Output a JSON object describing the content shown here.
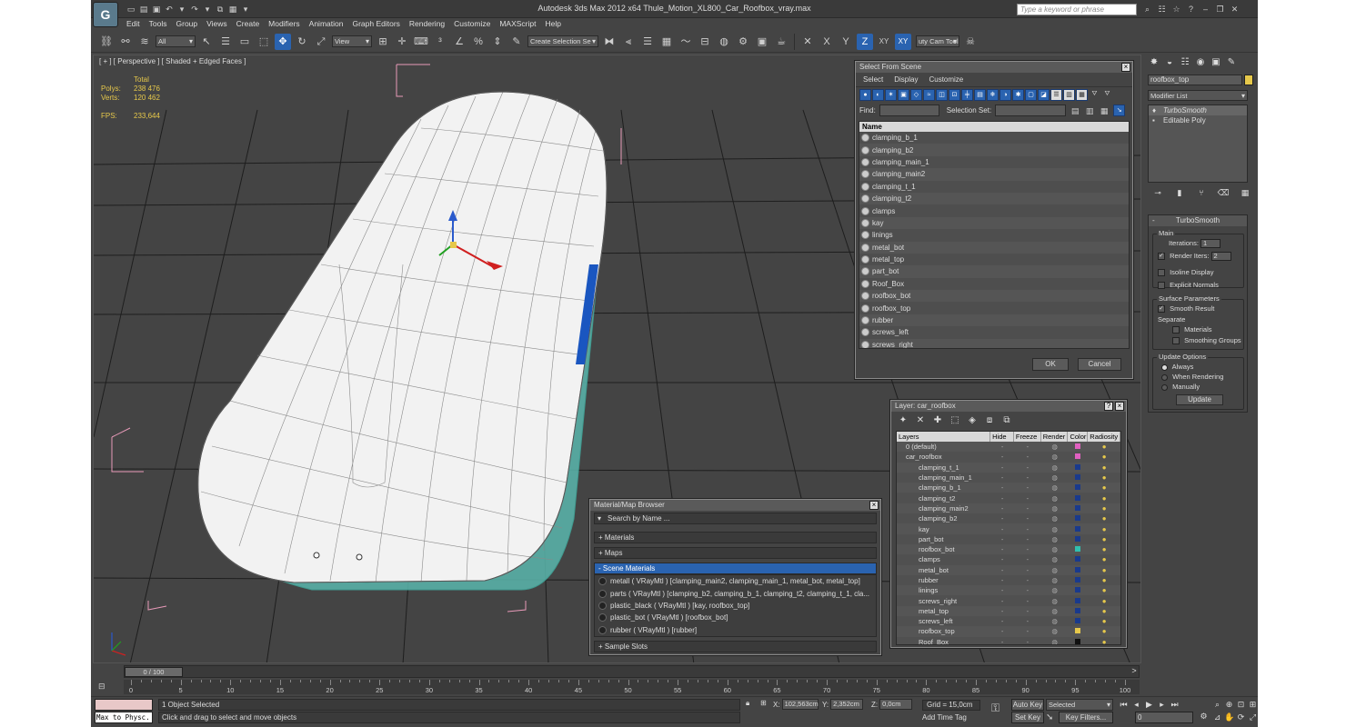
{
  "window": {
    "title": "Autodesk 3ds Max  2012 x64     Thule_Motion_XL800_Car_Roofbox_vray.max",
    "search_placeholder": "Type a keyword or phrase"
  },
  "menu": [
    "Edit",
    "Tools",
    "Group",
    "Views",
    "Create",
    "Modifiers",
    "Animation",
    "Graph Editors",
    "Rendering",
    "Customize",
    "MAXScript",
    "Help"
  ],
  "toolbar": {
    "filter": "All",
    "ref_coord": "View",
    "named_selection": "Create Selection Se",
    "axis_x": "X",
    "axis_y": "Y",
    "axis_z": "Z",
    "axis_xy": "XY",
    "axis_xy2": "XY",
    "camera_tool": "uty Cam Tool"
  },
  "viewport": {
    "label": "[ + ] [ Perspective ] [ Shaded + Edged Faces ]",
    "stats": {
      "header": "Total",
      "polys_label": "Polys:",
      "polys": "238 476",
      "verts_label": "Verts:",
      "verts": "120 462",
      "fps_label": "FPS:",
      "fps": "233,644"
    }
  },
  "select_from_scene": {
    "title": "Select From Scene",
    "menu": [
      "Select",
      "Display",
      "Customize"
    ],
    "find_label": "Find:",
    "selset_label": "Selection Set:",
    "column": "Name",
    "objects": [
      "clamping_b_1",
      "clamping_b2",
      "clamping_main_1",
      "clamping_main2",
      "clamping_t_1",
      "clamping_t2",
      "clamps",
      "kay",
      "linings",
      "metal_bot",
      "metal_top",
      "part_bot",
      "Roof_Box",
      "roofbox_bot",
      "roofbox_top",
      "rubber",
      "screws_left",
      "screws_right"
    ],
    "ok": "OK",
    "cancel": "Cancel"
  },
  "layer_dialog": {
    "title": "Layer: car_roofbox",
    "columns": [
      "Layers",
      "Hide",
      "Freeze",
      "Render",
      "Color",
      "Radiosity"
    ],
    "rows": [
      {
        "name": "0 (default)",
        "indent": 0,
        "color": "#e060c0"
      },
      {
        "name": "car_roofbox",
        "indent": 0,
        "color": "#e060c0"
      },
      {
        "name": "clamping_t_1",
        "indent": 1,
        "color": "#1a3a8c"
      },
      {
        "name": "clamping_main_1",
        "indent": 1,
        "color": "#1a3a8c"
      },
      {
        "name": "clamping_b_1",
        "indent": 1,
        "color": "#1a3a8c"
      },
      {
        "name": "clamping_t2",
        "indent": 1,
        "color": "#1a3a8c"
      },
      {
        "name": "clamping_main2",
        "indent": 1,
        "color": "#1a3a8c"
      },
      {
        "name": "clamping_b2",
        "indent": 1,
        "color": "#1a3a8c"
      },
      {
        "name": "kay",
        "indent": 1,
        "color": "#1a3a8c"
      },
      {
        "name": "part_bot",
        "indent": 1,
        "color": "#1a3a8c"
      },
      {
        "name": "roofbox_bot",
        "indent": 1,
        "color": "#30c0b0"
      },
      {
        "name": "clamps",
        "indent": 1,
        "color": "#1a3a8c"
      },
      {
        "name": "metal_bot",
        "indent": 1,
        "color": "#1a3a8c"
      },
      {
        "name": "rubber",
        "indent": 1,
        "color": "#1a3a8c"
      },
      {
        "name": "linings",
        "indent": 1,
        "color": "#1a3a8c"
      },
      {
        "name": "screws_right",
        "indent": 1,
        "color": "#1a3a8c"
      },
      {
        "name": "metal_top",
        "indent": 1,
        "color": "#1a3a8c"
      },
      {
        "name": "screws_left",
        "indent": 1,
        "color": "#1a3a8c"
      },
      {
        "name": "roofbox_top",
        "indent": 1,
        "color": "#e6c84b"
      },
      {
        "name": "Roof_Box",
        "indent": 1,
        "color": "#111111"
      }
    ]
  },
  "material_browser": {
    "title": "Material/Map Browser",
    "search_placeholder": "Search by Name ...",
    "sections": {
      "materials": "+ Materials",
      "maps": "+ Maps",
      "scene": "- Scene Materials",
      "samples": "+ Sample Slots"
    },
    "scene_materials": [
      "metall  ( VRayMtl ) [clamping_main2, clamping_main_1, metal_bot, metal_top]",
      "parts  ( VRayMtl ) [clamping_b2, clamping_b_1, clamping_t2, clamping_t_1, cla...",
      "plastic_black  ( VRayMtl ) [kay, roofbox_top]",
      "plastic_bot  ( VRayMtl ) [roofbox_bot]",
      "rubber  ( VRayMtl ) [rubber]"
    ]
  },
  "command_panel": {
    "object_name": "roofbox_top",
    "object_color": "#e6c84b",
    "modifier_list": "Modifier List",
    "stack": [
      "TurboSmooth",
      "Editable Poly"
    ],
    "rollout_title": "TurboSmooth",
    "main_label": "Main",
    "iterations_label": "Iterations:",
    "iterations": "1",
    "render_iters_label": "Render Iters:",
    "render_iters": "2",
    "isoline": "Isoline Display",
    "explicit_normals": "Explicit Normals",
    "surface_params": "Surface Parameters",
    "smooth_result": "Smooth Result",
    "separate": "Separate",
    "materials": "Materials",
    "smoothing_groups": "Smoothing Groups",
    "update_options": "Update Options",
    "always": "Always",
    "when_rendering": "When Rendering",
    "manually": "Manually",
    "update_btn": "Update"
  },
  "timeline": {
    "position": "0 / 100",
    "ticks": [
      "0",
      "5",
      "10",
      "15",
      "20",
      "25",
      "30",
      "35",
      "40",
      "45",
      "50",
      "55",
      "60",
      "65",
      "70",
      "75",
      "80",
      "85",
      "90",
      "95",
      "100"
    ]
  },
  "status": {
    "maxscript": "Max to Physc.",
    "selection": "1 Object Selected",
    "prompt": "Click and drag to select and move objects",
    "x_label": "X:",
    "x": "102,563cm",
    "y_label": "Y:",
    "y": "2,352cm",
    "z_label": "Z:",
    "z": "0,0cm",
    "grid": "Grid = 15,0cm",
    "add_time_tag": "Add Time Tag",
    "auto_key": "Auto Key",
    "set_key": "Set Key",
    "selected": "Selected",
    "key_filters": "Key Filters...",
    "frame": "0"
  }
}
